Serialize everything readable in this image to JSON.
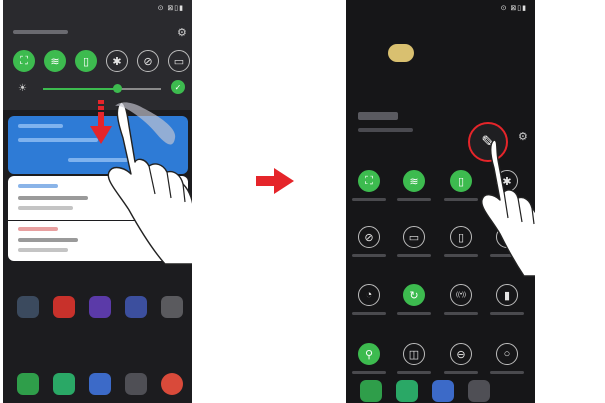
{
  "left_screen": {
    "status_icons": "⊙ ⊠▯▮",
    "quick_tiles": [
      {
        "icon": "screen-rotation-icon",
        "glyph": "⛶",
        "active": true
      },
      {
        "icon": "wifi-icon",
        "glyph": "≋",
        "active": true
      },
      {
        "icon": "vibrate-icon",
        "glyph": "▯",
        "active": true
      },
      {
        "icon": "bluetooth-icon",
        "glyph": "✱",
        "active": false
      },
      {
        "icon": "do-not-disturb-icon",
        "glyph": "⊘",
        "active": false
      },
      {
        "icon": "nfc-icon",
        "glyph": "▭",
        "active": false
      }
    ]
  },
  "right_screen": {
    "status_icons": "⊙ ⊠▯▮",
    "grid_tiles": [
      {
        "icon": "screen-rotation-icon",
        "glyph": "⛶",
        "active": true
      },
      {
        "icon": "wifi-icon",
        "glyph": "≋",
        "active": true
      },
      {
        "icon": "vibrate-icon",
        "glyph": "▯",
        "active": true
      },
      {
        "icon": "bluetooth-icon",
        "glyph": "✱",
        "active": false
      },
      {
        "icon": "do-not-disturb-icon",
        "glyph": "⊘",
        "active": false
      },
      {
        "icon": "nfc-icon",
        "glyph": "▭",
        "active": false
      },
      {
        "icon": "flashlight-icon",
        "glyph": "▯",
        "active": false
      },
      {
        "icon": "airplane-mode-icon",
        "glyph": "✈",
        "active": false
      },
      {
        "icon": "eye-comfort-icon",
        "glyph": "◔",
        "active": false
      },
      {
        "icon": "sync-icon",
        "glyph": "↻",
        "active": true
      },
      {
        "icon": "hotspot-icon",
        "glyph": "((•))",
        "active": false
      },
      {
        "icon": "battery-saver-icon",
        "glyph": "▮",
        "active": false
      },
      {
        "icon": "location-icon",
        "glyph": "⚲",
        "active": true
      },
      {
        "icon": "dual-window-icon",
        "glyph": "◫",
        "active": false
      },
      {
        "icon": "minus-circle-icon",
        "glyph": "⊖",
        "active": false
      },
      {
        "icon": "circle-icon",
        "glyph": "○",
        "active": false
      }
    ]
  },
  "colors": {
    "accent_green": "#3dbb4f",
    "arrow_red": "#e5252a",
    "notif_blue": "#2e7bd6"
  }
}
